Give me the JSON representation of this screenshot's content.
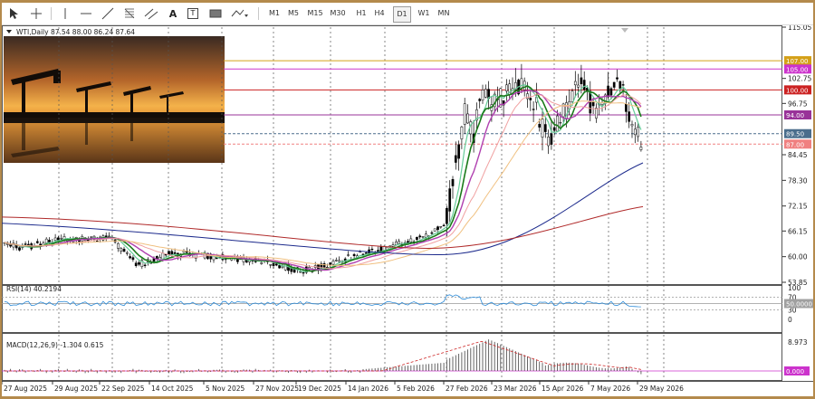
{
  "toolbar": {
    "timeframes": [
      "M1",
      "M5",
      "M15",
      "M30",
      "H1",
      "H4",
      "D1",
      "W1",
      "MN"
    ],
    "active_timeframe": "D1",
    "tool_text_icon": "A",
    "tool_label_icon": "T"
  },
  "chart": {
    "symbol_info": "WTI,Daily  87.54 88.00 86.24 87.64",
    "rsi_label": "RSI(14) 40.2194",
    "macd_label": "MACD(12,26,9) -1.304 0.615",
    "price_axis": [
      "115.05",
      "107.00",
      "105.00",
      "102.75",
      "100.00",
      "96.75",
      "94.00",
      "89.50",
      "87.00",
      "84.45",
      "78.30",
      "72.15",
      "66.15",
      "60.00",
      "53.85"
    ],
    "rsi_axis": [
      "100",
      "70",
      "50.0000",
      "30",
      "0"
    ],
    "macd_axis": [
      "8.973",
      "0.000"
    ],
    "dates": [
      "27 Aug 2025",
      "29 Aug 2025",
      "22 Sep 2025",
      "14 Oct 2025",
      "5 Nov 2025",
      "27 Nov 2025",
      "19 Dec 2025",
      "14 Jan 2026",
      "5 Feb 2026",
      "27 Feb 2026",
      "23 Mar 2026",
      "15 Apr 2026",
      "7 May 2026",
      "29 May 2026"
    ],
    "levels": [
      {
        "price": 107.0,
        "label": "107.00",
        "color": "#d4a017"
      },
      {
        "price": 105.0,
        "label": "105.00",
        "color": "#cc33cc"
      },
      {
        "price": 100.0,
        "label": "100.00",
        "color": "#cc2222"
      },
      {
        "price": 94.0,
        "label": "94.00",
        "color": "#993399"
      },
      {
        "price": 89.5,
        "label": "89.50",
        "color": "#4a6d8c"
      },
      {
        "price": 87.0,
        "label": "87.00",
        "color": "#f08080"
      }
    ]
  },
  "chart_data": {
    "type": "candlestick",
    "title": "WTI,Daily",
    "ylim": [
      53.85,
      115.05
    ],
    "close_approx": [
      {
        "date": "27 Aug 2025",
        "close": 63.5
      },
      {
        "date": "29 Aug 2025",
        "close": 64.0
      },
      {
        "date": "22 Sep 2025",
        "close": 63.0
      },
      {
        "date": "14 Oct 2025",
        "close": 58.0
      },
      {
        "date": "5 Nov 2025",
        "close": 61.0
      },
      {
        "date": "27 Nov 2025",
        "close": 58.5
      },
      {
        "date": "19 Dec 2025",
        "close": 57.0
      },
      {
        "date": "14 Jan 2026",
        "close": 61.5
      },
      {
        "date": "5 Feb 2026",
        "close": 65.0
      },
      {
        "date": "27 Feb 2026",
        "close": 90.0
      },
      {
        "date": "23 Mar 2026",
        "close": 100.0
      },
      {
        "date": "15 Apr 2026",
        "close": 88.0
      },
      {
        "date": "7 May 2026",
        "close": 98.0
      },
      {
        "date": "29 May 2026",
        "close": 87.64
      }
    ]
  }
}
